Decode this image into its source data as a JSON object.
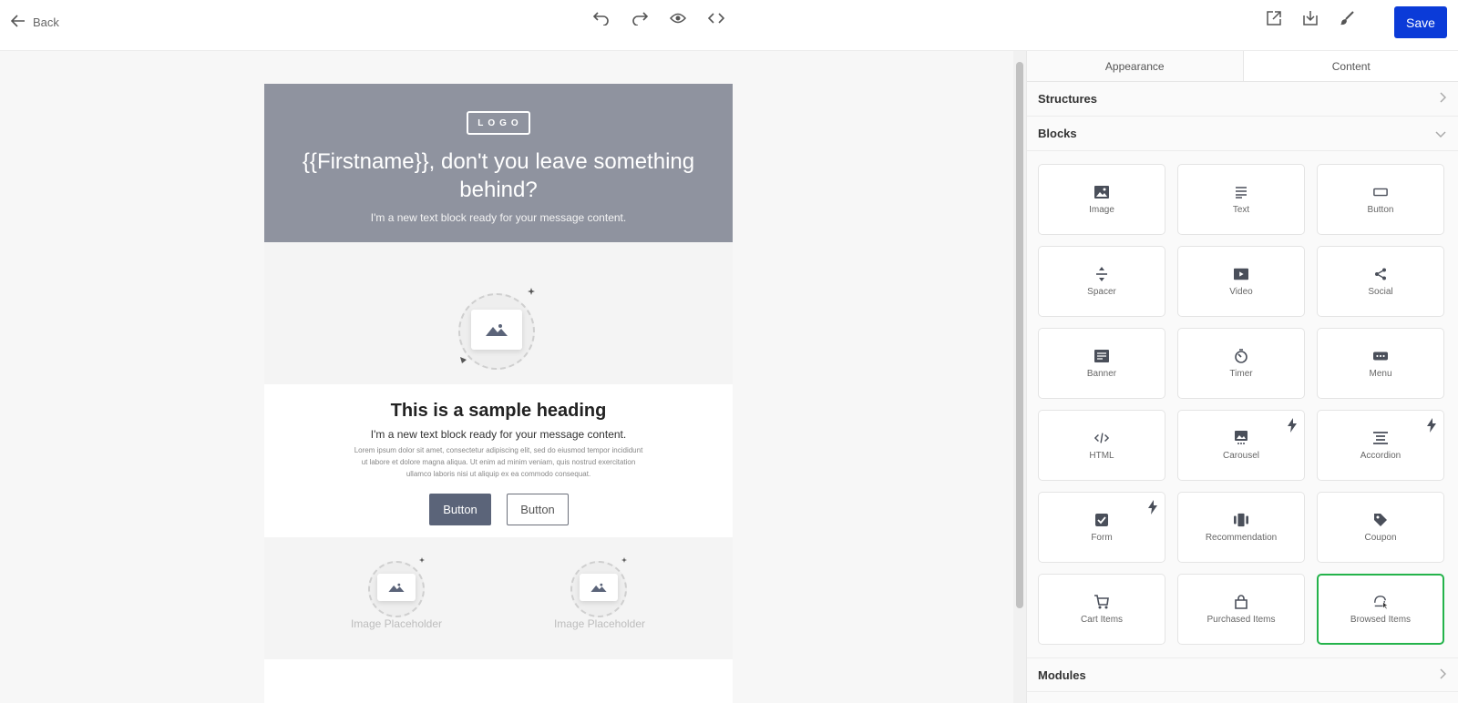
{
  "topbar": {
    "back_label": "Back",
    "tools": [
      "undo-icon",
      "redo-icon",
      "eye-icon",
      "code-icon"
    ],
    "right_tools": [
      "external-link-icon",
      "download-icon",
      "brush-icon"
    ],
    "save_label": "Save"
  },
  "email": {
    "logo_text": "LOGO",
    "hero_title": "{{Firstname}}, don't you leave something behind?",
    "hero_text": "I'm a new text block ready for your message content.",
    "heading": "This is a sample heading",
    "subtext": "I'm a new text block ready for your message content.",
    "lorem": "Lorem ipsum dolor sit amet, consectetur adipiscing elit, sed do eiusmod tempor incididunt ut labore et dolore magna aliqua. Ut enim ad minim veniam, quis nostrud exercitation ullamco laboris nisi ut aliquip ex ea commodo consequat.",
    "button_primary": "Button",
    "button_secondary": "Button",
    "placeholder_left": "Image Placeholder",
    "placeholder_right": "Image Placeholder"
  },
  "panel": {
    "tabs": [
      {
        "label": "Appearance",
        "active": false
      },
      {
        "label": "Content",
        "active": true
      }
    ],
    "structures_label": "Structures",
    "blocks_label": "Blocks",
    "modules_label": "Modules",
    "blocks": [
      {
        "label": "Image",
        "icon": "image-icon"
      },
      {
        "label": "Text",
        "icon": "text-icon"
      },
      {
        "label": "Button",
        "icon": "button-icon"
      },
      {
        "label": "Spacer",
        "icon": "spacer-icon"
      },
      {
        "label": "Video",
        "icon": "video-icon"
      },
      {
        "label": "Social",
        "icon": "share-icon"
      },
      {
        "label": "Banner",
        "icon": "banner-icon"
      },
      {
        "label": "Timer",
        "icon": "timer-icon"
      },
      {
        "label": "Menu",
        "icon": "menu-icon"
      },
      {
        "label": "HTML",
        "icon": "html-icon"
      },
      {
        "label": "Carousel",
        "icon": "carousel-icon",
        "bolt": true
      },
      {
        "label": "Accordion",
        "icon": "accordion-icon",
        "bolt": true
      },
      {
        "label": "Form",
        "icon": "form-icon",
        "bolt": true
      },
      {
        "label": "Recommendation",
        "icon": "recommendation-icon"
      },
      {
        "label": "Coupon",
        "icon": "coupon-icon"
      },
      {
        "label": "Cart Items",
        "icon": "cart-icon"
      },
      {
        "label": "Purchased Items",
        "icon": "bag-icon"
      },
      {
        "label": "Browsed Items",
        "icon": "browsed-icon",
        "selected": true
      }
    ],
    "accent_color": "#24b34b",
    "save_color": "#0b3bd8"
  }
}
